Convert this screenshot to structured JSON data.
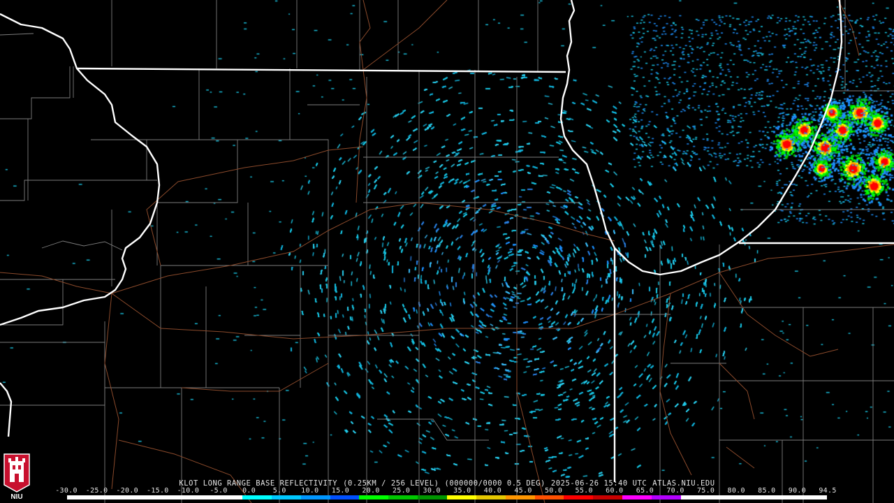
{
  "header": {
    "station": "KLOT LONG RANGE BASE REFLECTIVITY",
    "resolution": "(0.25KM / 256 LEVEL)",
    "scan": "(000000/0000 0.5 DEG)",
    "timestamp": "2025-06-26 15:40 UTC",
    "source": "ATLAS.NIU.EDU"
  },
  "logo": {
    "text": "NIU",
    "icon": "niu-castle-icon",
    "color": "#c8102e"
  },
  "colors": {
    "background": "#000000",
    "state_border": "#ffffff",
    "county_border": "#8a8a8a",
    "highway": "#8b4a2b"
  },
  "scale": {
    "labels": [
      "-30.0",
      "-25.0",
      "-20.0",
      "-15.0",
      "-10.0",
      "-5.0",
      "0.0",
      "5.0",
      "10.0",
      "15.0",
      "20.0",
      "25.0",
      "30.0",
      "35.0",
      "40.0",
      "45.0",
      "50.0",
      "55.0",
      "60.0",
      "65.0",
      "70.0",
      "75.0",
      "80.0",
      "85.0",
      "90.0",
      "94.5"
    ],
    "colors": [
      "#ffffff",
      "#ffffff",
      "#ffffff",
      "#ffffff",
      "#ffffff",
      "#ffffff",
      "#00ffff",
      "#00c8ff",
      "#0096ff",
      "#0050ff",
      "#00ff00",
      "#00c800",
      "#009600",
      "#ffff00",
      "#e6c800",
      "#ff9600",
      "#ff5000",
      "#ff0000",
      "#c80000",
      "#ff00ff",
      "#b400ff",
      "#ffffff",
      "#ffffff",
      "#ffffff",
      "#ffffff",
      "#ffffff"
    ]
  }
}
